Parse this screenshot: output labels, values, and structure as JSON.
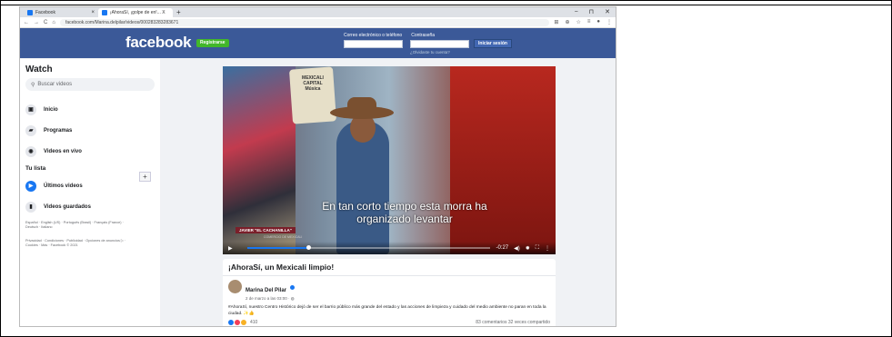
{
  "browser": {
    "tabs": [
      {
        "label": "Facebook"
      },
      {
        "label": "¡AhoraSí, ¡golpe de en!... X"
      }
    ],
    "new_tab": "+",
    "url": "facebook.com/Marina.delpilar/videos/000283283283671",
    "window_controls": [
      "−",
      "⊓",
      "✕"
    ]
  },
  "header": {
    "logo": "facebook",
    "register_label": "Registrarse",
    "email_label": "Correo electrónico o teléfono",
    "password_label": "Contraseña",
    "forgot_label": "¿Olvidaste tu cuenta?",
    "login_label": "Iniciar sesión"
  },
  "sidebar": {
    "title": "Watch",
    "search_placeholder": "Buscar videos",
    "items": [
      {
        "label": "Inicio",
        "icon": "tv-icon"
      },
      {
        "label": "Programas",
        "icon": "clapper-icon"
      },
      {
        "label": "Videos en vivo",
        "icon": "live-icon"
      }
    ],
    "section": "Tu lista",
    "list_items": [
      {
        "label": "Últimos videos",
        "icon": "play-icon"
      },
      {
        "label": "Videos guardados",
        "icon": "bookmark-icon"
      }
    ],
    "languages": "Español · English (US) · Português (Brasil) · Français (France) · Deutsch · Italiano",
    "footer": "Privacidad · Condiciones · Publicidad · Opciones de anuncios ▷ · Cookies · Más · Facebook © 2021"
  },
  "video": {
    "sign_text": "MEXICALI CAPITAL Música",
    "subtitle": "En tan corto tiempo esta morra ha organizado levantar",
    "nameplate": "JAVIER \"EL CACHANILLA\"",
    "nameplate_sub": "COMERCIO DE MEXICALI",
    "time": "-0:27",
    "progress": 0.25
  },
  "post": {
    "title": "¡AhoraSí, un Mexicali limpio!",
    "author": "Marina Del Pilar",
    "date": "2 de marzo a las 03:00 · ",
    "text": "#AhoraSí, nuestro Centro Histórico dejó de ser el barrio público más grande del estado y las acciones de limpieza y cuidado del medio ambiente no paran en toda la ciudad. ✨👍",
    "reactions_count": "410",
    "comments_shares": "83 comentarios  32 veces compartido"
  }
}
